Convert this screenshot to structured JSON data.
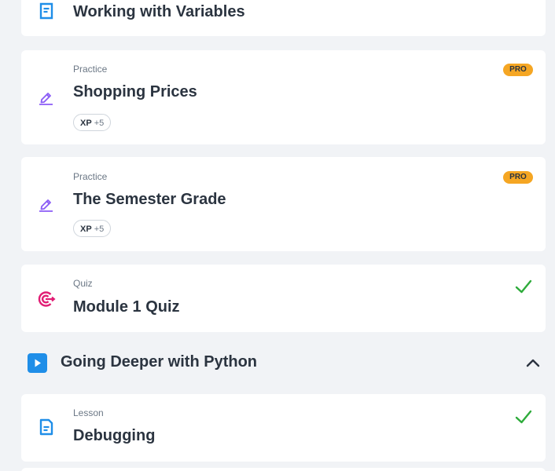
{
  "cards": [
    {
      "title": "Working with Variables",
      "icon": "lesson-icon"
    },
    {
      "type": "Practice",
      "title": "Shopping Prices",
      "badge": "PRO",
      "xp_label": "XP",
      "xp_value": "+5",
      "icon": "practice-icon"
    },
    {
      "type": "Practice",
      "title": "The Semester Grade",
      "badge": "PRO",
      "xp_label": "XP",
      "xp_value": "+5",
      "icon": "practice-icon"
    },
    {
      "type": "Quiz",
      "title": "Module 1 Quiz",
      "status": "completed",
      "icon": "quiz-target-icon"
    }
  ],
  "section": {
    "title": "Going Deeper with Python",
    "icon": "play-icon",
    "expanded": true
  },
  "section_cards": [
    {
      "type": "Lesson",
      "title": "Debugging",
      "status": "completed",
      "icon": "lesson-icon"
    }
  ],
  "colors": {
    "background": "#f1f3f6",
    "card": "#ffffff",
    "text": "#2b3440",
    "muted": "#6b7785",
    "accent_blue": "#1f8ee8",
    "practice_purple": "#8b5cf6",
    "quiz_pink": "#e11d74",
    "pro_badge": "#f5a623",
    "check_green": "#2eab3b"
  }
}
